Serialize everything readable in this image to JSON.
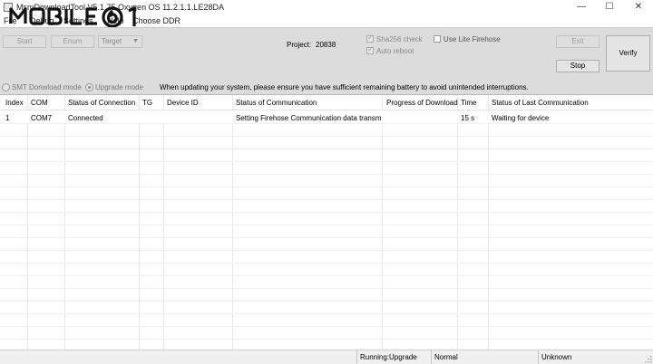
{
  "window": {
    "title": "MsmDownloadTool V5.1.75 Oxygen OS 11.2.1.1.LE28DA",
    "min_glyph": "—",
    "max_glyph": "☐",
    "close_glyph": "✕"
  },
  "menu": {
    "items": [
      "File",
      "Debug",
      "Settings",
      "Help",
      "Choose DDR"
    ]
  },
  "toolbar": {
    "start_label": "Start",
    "enum_label": "Enum",
    "target_label": "Target",
    "project_label": "Project:",
    "project_value": "20838",
    "sha256_label": "Sha256 check",
    "sha256_checked": true,
    "auto_reboot_label": "Auto reboot",
    "auto_reboot_checked": true,
    "lite_firehose_label": "Use Lite Firehose",
    "lite_firehose_checked": false,
    "exit_label": "Exit",
    "stop_label": "Stop",
    "verify_label": "Verify"
  },
  "modes": {
    "smt_label": "SMT Donwload mode",
    "upgrade_label": "Upgrade mode",
    "selected": "upgrade",
    "warning": "When updating your system, please ensure you have sufficient remaining battery to avoid unintended interruptions."
  },
  "table": {
    "columns": [
      "Index",
      "COM",
      "Status of Connection",
      "TG",
      "Device ID",
      "Status of Communication",
      "Progress of Download",
      "Time",
      "Status of Last Communication"
    ],
    "rows": [
      [
        "1",
        "COM7",
        "Connected",
        "",
        "",
        "Setting Firehose Communication data transmi...",
        "",
        "15 s",
        "Waiting for device"
      ]
    ]
  },
  "statusbar": {
    "running": "Running:Upgrade",
    "mode": "Normal",
    "state": "Unknown"
  },
  "colors": {
    "panel": "#dcdcdc",
    "table_bg": "#ffffff",
    "status_bg": "#f0f0f0",
    "watermark": "#111111"
  }
}
